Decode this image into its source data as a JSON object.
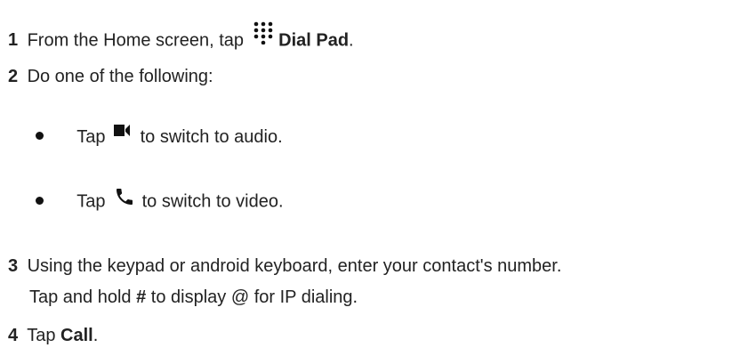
{
  "steps": [
    {
      "number": "1",
      "pre": "From the Home screen, tap",
      "bold": "Dial Pad",
      "post": "."
    },
    {
      "number": "2",
      "text": "Do one of the following:"
    },
    {
      "number": "3",
      "text": "Using the keypad or android keyboard, enter your contact's number."
    },
    {
      "number": "4",
      "pre": "Tap",
      "bold": "Call",
      "post": "."
    }
  ],
  "bullets": [
    {
      "pre": "Tap",
      "post": "to switch to audio.",
      "icon": "video-camera-icon"
    },
    {
      "pre": "Tap",
      "post": "to switch to video.",
      "icon": "phone-handset-icon"
    }
  ],
  "step3_note": {
    "pre": "Tap and hold",
    "bold": "#",
    "post": "to display @ for IP dialing."
  },
  "icons": {
    "dialpad": "dialpad-icon"
  }
}
